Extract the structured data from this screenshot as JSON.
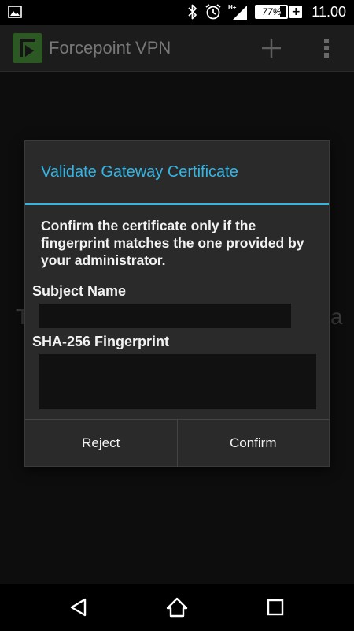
{
  "status_bar": {
    "time": "11.00",
    "battery_percent": "77%",
    "battery_level": 0.77,
    "battery_charging_glyph": "+",
    "network_label": "H+",
    "icons": [
      "image-icon",
      "bluetooth-icon",
      "alarm-icon",
      "signal-icon",
      "battery-icon"
    ]
  },
  "app_bar": {
    "title": "Forcepoint VPN",
    "logo_icon": "forcepoint-logo-icon",
    "actions": [
      "add-icon",
      "overflow-menu-icon"
    ]
  },
  "background": {
    "partial_text_left": "T",
    "partial_text_right": "a"
  },
  "dialog": {
    "title": "Validate Gateway Certificate",
    "message": "Confirm the certificate only if the fingerprint matches the one provided by your administrator.",
    "subject_label": "Subject Name",
    "subject_value": "",
    "fingerprint_label": "SHA-256 Fingerprint",
    "fingerprint_value": "",
    "reject_label": "Reject",
    "confirm_label": "Confirm",
    "accent_color": "#33b5e5"
  },
  "nav_bar": {
    "buttons": [
      "back-icon",
      "home-icon",
      "recents-icon"
    ]
  }
}
